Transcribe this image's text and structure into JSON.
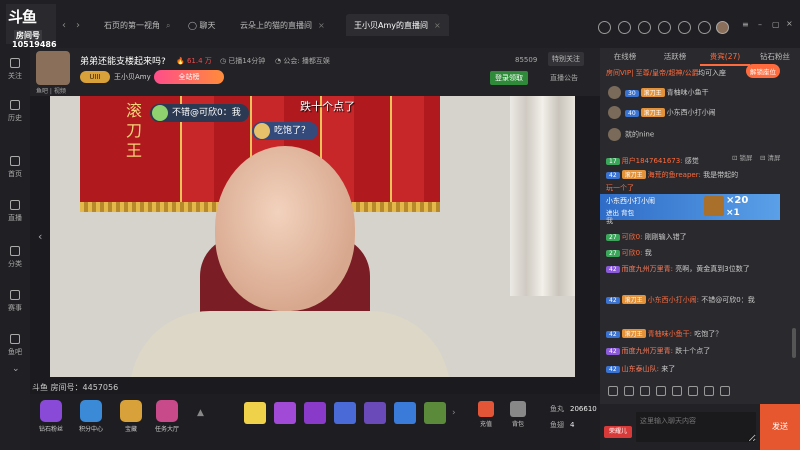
{
  "topbar": {
    "brand": "斗鱼",
    "room_label": "房间号",
    "room_id": "10519486",
    "tabs": [
      {
        "label": "石页的第一视角"
      },
      {
        "label": "聊天"
      },
      {
        "label": "云朵上的猫的直播间"
      },
      {
        "label": "王小贝Amy的直播间"
      }
    ]
  },
  "sidebar": {
    "items": [
      {
        "label": "关注"
      },
      {
        "label": "历史"
      },
      {
        "label": "首页"
      },
      {
        "label": "直播"
      },
      {
        "label": "分类"
      },
      {
        "label": "赛事"
      },
      {
        "label": "鱼吧"
      }
    ]
  },
  "stream": {
    "title": "弟弟还能支楼起来吗?",
    "hot": "61.4 万",
    "live_time": "已播14分钟",
    "notice": "公会: 播都互娱",
    "room_number": "85509",
    "special_label": "特别关注",
    "badge": "UIII",
    "anchor": "王小贝Amy",
    "rank_label": "全站榜",
    "login_label": "登录领取",
    "announcement": "直播公告",
    "subinfo": "鱼吧 | 视频"
  },
  "video": {
    "banner_text": "滚刀王",
    "danmu": [
      {
        "text": "不错@可欣0：我"
      },
      {
        "text": "吃饱了？"
      },
      {
        "text": "跌十个点了"
      }
    ]
  },
  "below_video": {
    "room_line": "斗鱼 房间号：4457056",
    "icons": [
      {
        "label": "钻石粉丝"
      },
      {
        "label": "积分中心"
      },
      {
        "label": "宝藏"
      },
      {
        "label": "任务大厅"
      }
    ],
    "recharge_label": "充值",
    "backpack_label": "背包",
    "fish_balls_label": "鱼丸",
    "fish_balls_value": "206610",
    "fish_fins_label": "鱼翅",
    "fish_fins_value": "4"
  },
  "right": {
    "tabs": [
      {
        "label": "在线榜"
      },
      {
        "label": "活跃榜"
      },
      {
        "label": "贵宾(27)"
      },
      {
        "label": "钻石粉丝"
      }
    ],
    "vip_info": "房间VIP| 至尊/皇帝/超神/公爵",
    "vip_tail": "均可入座",
    "unlock_label": "解锁座位",
    "vip_list": [
      {
        "level": "30",
        "badge": "滚刀王",
        "name": "青柚味小鱼干"
      },
      {
        "level": "40",
        "badge": "滚刀王",
        "name": "小东西小打小闹"
      },
      {
        "level": "",
        "badge": "",
        "name": "就的nine"
      }
    ],
    "chat": [
      {
        "level": "17",
        "name": "用户1847641673:",
        "text": "感觉"
      },
      {
        "level": "42",
        "badge": "滚刀王",
        "name": "海荒的鱼reaper:",
        "text": "我是带起的"
      },
      {
        "level": "",
        "name": "",
        "text": "玩一个了"
      },
      {
        "level": "",
        "name": "",
        "text": "我"
      },
      {
        "level": "27",
        "name": "可欣0:",
        "text": "刚刚输入错了"
      },
      {
        "level": "27",
        "name": "可欣0:",
        "text": "我"
      },
      {
        "level": "42",
        "name": "而度九州万里青:",
        "text": "亮啊，黄金真到3位数了"
      },
      {
        "level": "42",
        "badge": "滚刀王",
        "name": "小东西小打小闹:",
        "text": "不错@可欣0：我"
      },
      {
        "level": "42",
        "badge": "滚刀王",
        "name": "青柚味小鱼干:",
        "text": "吃饱了？"
      },
      {
        "level": "42",
        "name": "而度九州万里青:",
        "text": "跌十个点了"
      },
      {
        "level": "42",
        "name": "山东泰山队:",
        "text": "来了"
      }
    ],
    "popup": {
      "name": "小东西小打小闹",
      "out_label": "进出",
      "bag_label": "背包",
      "count_x20": "×20",
      "count_x1": "×1"
    },
    "input_placeholder": "这里输入聊天内容",
    "user_label": "荣耀儿",
    "send_label": "发送"
  }
}
